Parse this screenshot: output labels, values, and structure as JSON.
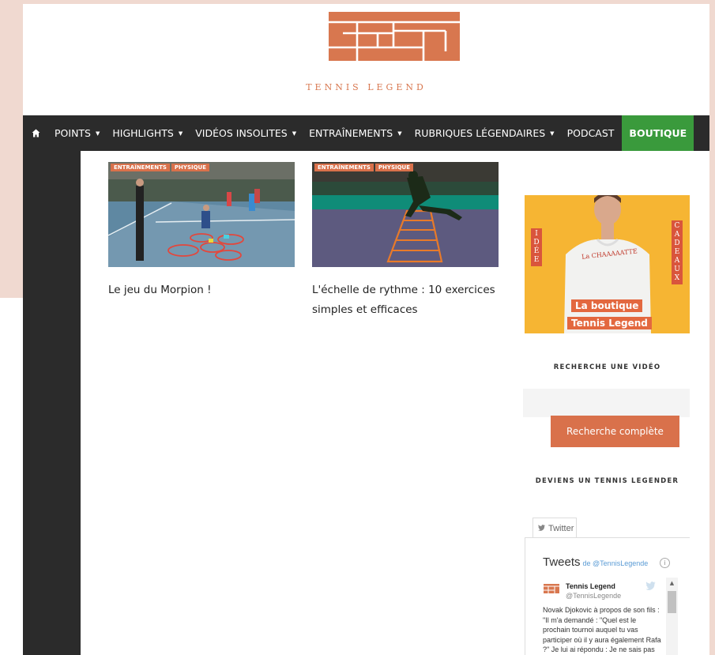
{
  "site": {
    "brand_text": "TENNIS LEGEND",
    "brand_color": "#d8774f"
  },
  "nav": {
    "home_icon": "home-icon",
    "items": [
      {
        "label": "POINTS",
        "has_dropdown": true
      },
      {
        "label": "HIGHLIGHTS",
        "has_dropdown": true
      },
      {
        "label": "VIDÉOS INSOLITES",
        "has_dropdown": true
      },
      {
        "label": "ENTRAÎNEMENTS",
        "has_dropdown": true
      },
      {
        "label": "RUBRIQUES LÉGENDAIRES",
        "has_dropdown": true
      },
      {
        "label": "PODCAST",
        "has_dropdown": false
      }
    ],
    "caret": "▼",
    "boutique_label": "BOUTIQUE",
    "boutique_color": "#3a9a3c",
    "background": "#2b2b2b"
  },
  "articles": [
    {
      "tags": [
        "ENTRAÎNEMENTS",
        "PHYSIQUE"
      ],
      "title": "Le jeu du Morpion !"
    },
    {
      "tags": [
        "ENTRAÎNEMENTS",
        "PHYSIQUE"
      ],
      "title_line1": "L'échelle de rythme : 10 exercices",
      "title_line2": "simples et efficaces"
    }
  ],
  "sidebar": {
    "promo": {
      "left_word": [
        "I",
        "D",
        "É",
        "E"
      ],
      "right_word": [
        "C",
        "A",
        "D",
        "E",
        "A",
        "U",
        "X"
      ],
      "shirt_text": "La CHAAAAATTE",
      "badge_line1": "La boutique",
      "badge_line2": "Tennis Legend"
    },
    "search_title": "RECHERCHE UNE VIDÉO",
    "search_placeholder": "",
    "search_button": "Recherche complète",
    "tennis_legender_title": "DEVIENS UN TENNIS LEGENDER",
    "twitter_tab": "Twitter",
    "tweets_heading": "Tweets",
    "tweets_by": "de @TennisLegende",
    "tweet_author": "Tennis Legend",
    "tweet_handle": "@TennisLegende",
    "tweet_text": "Novak Djokovic à propos de son fils : \"Il m'a demandé : \"Quel est le prochain tournoi auquel tu vas participer où il y aura également Rafa ?\" Je lui ai répondu : Je ne sais pas"
  }
}
